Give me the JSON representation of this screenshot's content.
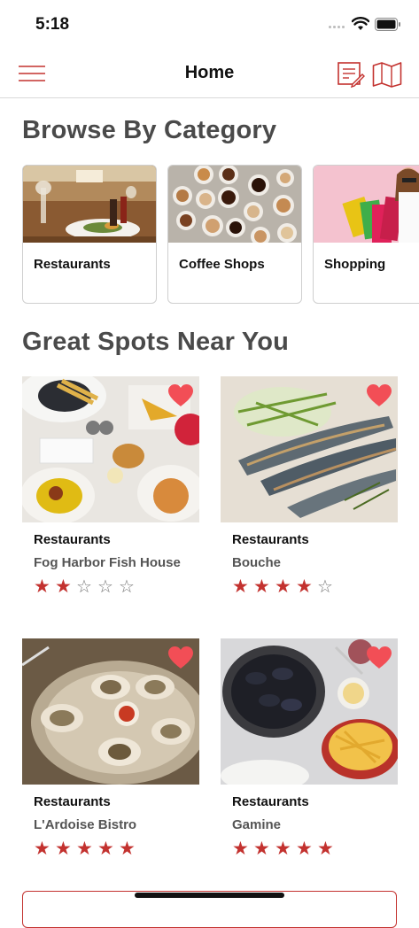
{
  "status": {
    "time": "5:18"
  },
  "nav": {
    "title": "Home",
    "menu_icon": "hamburger-menu-icon",
    "list_icon": "list-edit-icon",
    "map_icon": "map-icon",
    "accent": "#c3322f"
  },
  "sections": {
    "categories_title": "Browse By Category",
    "spots_title": "Great Spots Near You"
  },
  "categories": [
    {
      "label": "Restaurants"
    },
    {
      "label": "Coffee Shops"
    },
    {
      "label": "Shopping"
    }
  ],
  "spots": [
    {
      "category": "Restaurants",
      "name": "Fog Harbor Fish House",
      "rating": 2,
      "favorite": true
    },
    {
      "category": "Restaurants",
      "name": "Bouche",
      "rating": 4,
      "favorite": true
    },
    {
      "category": "Restaurants",
      "name": "L'Ardoise Bistro",
      "rating": 5,
      "favorite": true
    },
    {
      "category": "Restaurants",
      "name": "Gamine",
      "rating": 5,
      "favorite": true
    }
  ]
}
